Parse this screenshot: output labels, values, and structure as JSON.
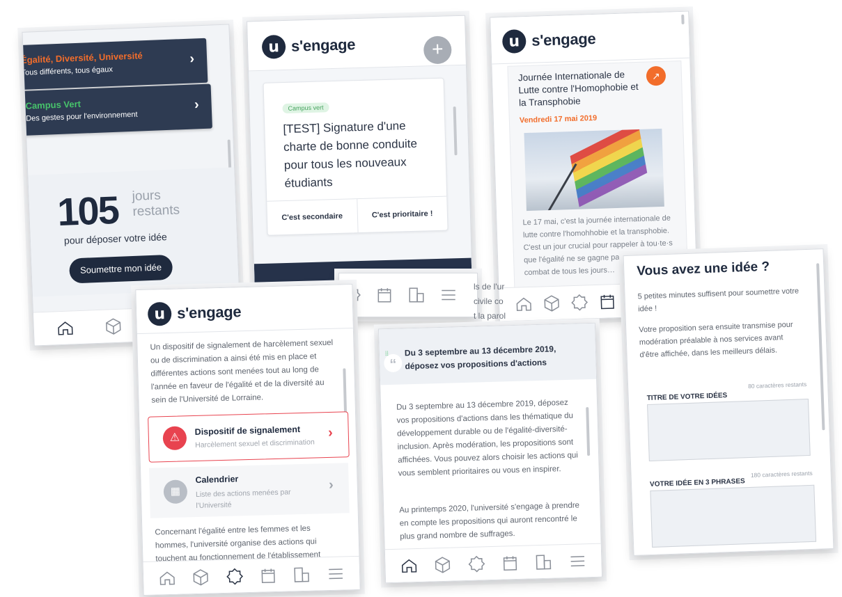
{
  "screen1": {
    "items": [
      {
        "title": "Égalité, Diversité, Université",
        "subtitle": "Tous différents, tous égaux",
        "color": "#f26d2b"
      },
      {
        "title": "Campus Vert",
        "subtitle": "Des gestes pour l'environnement",
        "color": "#47c36b"
      }
    ],
    "count": "105",
    "count_unit_1": "jours",
    "count_unit_2": "restants",
    "count_caption": "pour déposer votre idée",
    "submit_label": "Soumettre mon idée"
  },
  "screen2": {
    "logo_letter": "u",
    "logo_text": "s'engage",
    "tag": "Campus vert",
    "title": "[TEST] Signature d'une charte de bonne conduite pour tous les nouveaux étudiants",
    "vote_secondary": "C'est secondaire",
    "vote_priority": "C'est prioritaire !"
  },
  "screen3": {
    "logo_text": "s'engage",
    "event_title": "Journée Internationale de Lutte contre l'Homophobie et la Transphobie",
    "event_date": "Vendredi 17 mai 2019",
    "body": "Le 17 mai, c'est la journée internationale de lutte contre l'homohhobie et la transphobie. C'est un jour crucial pour rappeler à tou·te·s que l'égalité ne se gagne pas définitivemen… combat de tous les jours…"
  },
  "screen4": {
    "logo_text": "s'engage",
    "intro": "Un dispositif de signalement de harcèlement sexuel ou de discrimination a ainsi été mis en place et différentes actions sont menées tout au long de l'année en faveur de l'égalité et de la diversité au sein de l'Université de Lorraine.",
    "items": [
      {
        "title": "Dispositif de signalement",
        "subtitle": "Harcèlement sexuel et discrimination"
      },
      {
        "title": "Calendrier",
        "subtitle": "Liste des actions menées par l'Université"
      }
    ],
    "outro": "Concernant l'égalité entre les femmes et les hommes, l'université organise des actions qui touchent au fonctionnement de l'établissement"
  },
  "screen5": {
    "peek_lines": [
      "ls de l'ur",
      "civile co",
      "t la parol"
    ]
  },
  "screen6": {
    "header": "Du 3 septembre au 13 décembre 2019, déposez vos propositions d'actions",
    "para1": "Du 3 septembre au 13 décembre 2019, déposez vos propositions d'actions dans les thématique du développement durable ou de l'égalité-diversité-inclusion. Après modération, les propositions sont affichées. Vous pouvez alors choisir les actions qui vous semblent prioritaires ou vous en inspirer.",
    "para2": "Au printemps 2020, l'université s'engage à prendre en compte les propositions qui auront rencontré le plus grand nombre de suffrages."
  },
  "screen7": {
    "title": "Vous avez une idée ?",
    "p1": "5 petites minutes suffisent pour soumettre votre idée !",
    "p2": "Votre proposition sera ensuite transmise pour modération préalable à nos services avant d'être affichée, dans les meilleurs délais.",
    "field1_label": "TITRE DE VOTRE IDÉES",
    "field1_counter": "80 caractères restants",
    "field2_label": "VOTRE IDÉE EN 3 PHRASES",
    "field2_counter": "180 caractères restants"
  },
  "colors": {
    "navy": "#1f2a3e",
    "orange": "#f26d2b",
    "green": "#47c36b",
    "alert_red": "#e8434f"
  },
  "nav_icons": [
    "home-icon",
    "cube-icon",
    "badge-icon",
    "calendar-icon",
    "building-icon",
    "menu-icon"
  ]
}
